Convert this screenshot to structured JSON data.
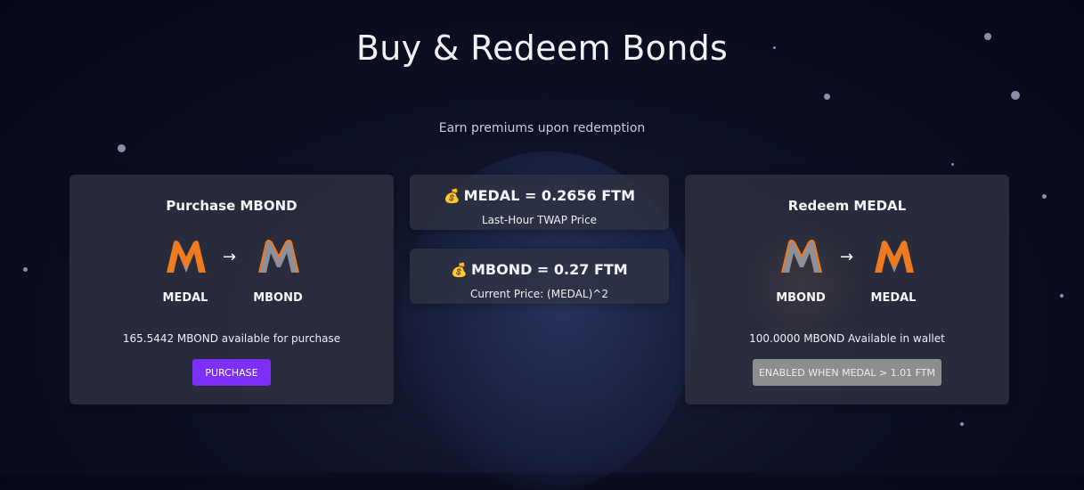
{
  "page": {
    "title": "Buy & Redeem Bonds",
    "subtitle": "Earn premiums upon redemption"
  },
  "purchase_card": {
    "title": "Purchase MBOND",
    "from_token": "MEDAL",
    "to_token": "MBOND",
    "arrow": "→",
    "info": "165.5442 MBOND available for purchase",
    "button_label": "PURCHASE"
  },
  "price_medal": {
    "icon": "💰",
    "main": "MEDAL = 0.2656 FTM",
    "sub": "Last-Hour TWAP Price"
  },
  "price_mbond": {
    "icon": "💰",
    "main": "MBOND = 0.27 FTM",
    "sub": "Current Price: (MEDAL)^2"
  },
  "redeem_card": {
    "title": "Redeem MEDAL",
    "from_token": "MBOND",
    "to_token": "MEDAL",
    "arrow": "→",
    "info": "100.0000 MBOND Available in wallet",
    "button_label": "ENABLED WHEN MEDAL > 1.01 FTM"
  },
  "colors": {
    "accent": "#7b2ff7",
    "medal_orange": "#f07a1f",
    "medal_gray": "#8f8f99",
    "disabled": "#8d8d8d"
  }
}
